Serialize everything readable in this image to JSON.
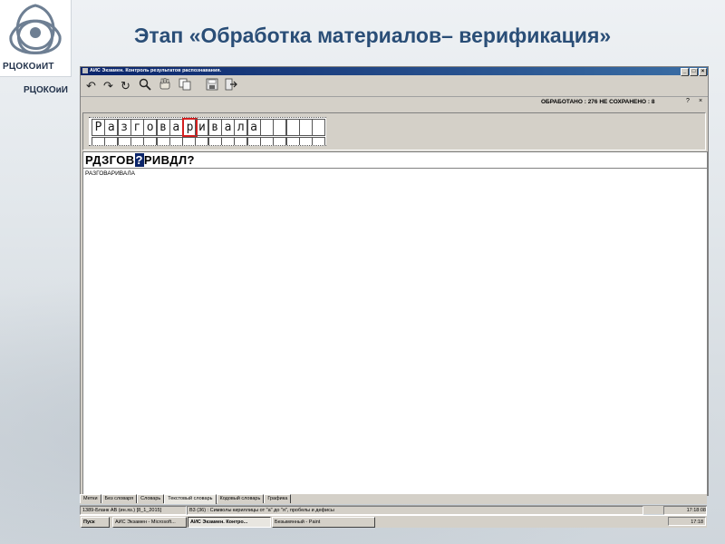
{
  "slide": {
    "title": "Этап «Обработка материалов– верификация»",
    "logo_text": "РЦОКОиИТ",
    "logo_text_echo": "РЦОКОиИ"
  },
  "window": {
    "title": "АИС Экзамен. Контроль результатов распознавания.",
    "controls": [
      "_",
      "□",
      "×"
    ]
  },
  "toolbar": {
    "icons": [
      "undo-icon",
      "redo-icon",
      "refresh-icon",
      "zoom-icon",
      "hand-icon",
      "copy-icon",
      "save-icon",
      "exit-icon"
    ]
  },
  "counter": {
    "text": "ОБРАБОТАНО : 276    НЕ СОХРАНЕНО : 8"
  },
  "help": {
    "question": "?",
    "close": "×"
  },
  "handwriting": {
    "letters": [
      "Р",
      "а",
      "з",
      "г",
      "о",
      "в",
      "а",
      "р",
      "и",
      "в",
      "а",
      "л",
      "а",
      "",
      "",
      "",
      "",
      ""
    ],
    "selected_index": 7
  },
  "recognized": {
    "before": "РДЗГОВ",
    "unknown": "?",
    "after": "РИВДЛ?"
  },
  "suggestions": [
    "РАЗГОВАРИВАЛА"
  ],
  "tabs": [
    "Метки",
    "Без словаря",
    "Словарь",
    "Текстовый словарь",
    "Кодовый словарь",
    "Графика"
  ],
  "active_tab": 3,
  "statusbar": {
    "file": "1389-Бланк АВ (ин.яз.) [8_1_2015]",
    "field": "В3 (36) : Символы кириллицы от \"а\" до \"я\", пробелы и дефисы",
    "time": "17:18:08"
  },
  "taskbar": {
    "start": "Пуск",
    "tasks": [
      "АИС Экзамен - Microsoft...",
      "АИС Экзамен. Контро...",
      "Безымянный - Paint"
    ],
    "active_task": 1,
    "clock": "17:18"
  },
  "colors": {
    "title_blue": "#2a4e77",
    "titlebar": "#0a246a",
    "selection_red": "#d42020",
    "window_gray": "#d4d0c8"
  }
}
